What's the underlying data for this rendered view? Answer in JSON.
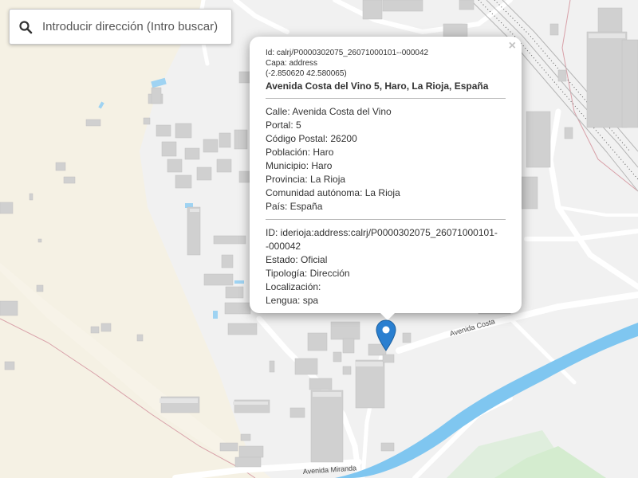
{
  "search": {
    "placeholder": "Introducir dirección (Intro buscar)"
  },
  "popup": {
    "close_label": "×",
    "id_line": "Id: calrj/P0000302075_26071000101--000042",
    "layer_line": "Capa: address",
    "coords_line": "(-2.850620 42.580065)",
    "title": "Avenida Costa del Vino 5, Haro, La Rioja, España",
    "section1": [
      "Calle: Avenida Costa del Vino",
      "Portal: 5",
      "Código Postal: 26200",
      "Población: Haro",
      "Municipio: Haro",
      "Provincia: La Rioja",
      "Comunidad autónoma: La Rioja",
      "País: España"
    ],
    "section2": [
      "ID: iderioja:address:calrj/P0000302075_26071000101-",
      "-000042",
      "Estado: Oficial",
      "Tipología: Dirección",
      "Localización:",
      "Lengua: spa"
    ]
  },
  "map": {
    "road_label_1": "Avenida Miranda",
    "road_label_2": "Avenida Costa",
    "marker_color": "#2a7fd0",
    "river_color": "#7fc6f0"
  }
}
